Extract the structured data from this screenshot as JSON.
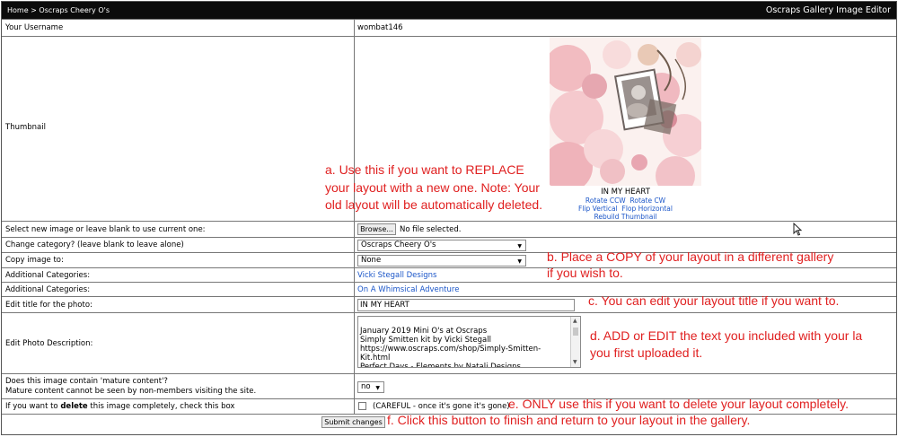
{
  "header": {
    "breadcrumb_home": "Home",
    "breadcrumb_sep": ">",
    "breadcrumb_gallery": "Oscraps Cheery O's",
    "title": "Oscraps Gallery Image Editor"
  },
  "form": {
    "username_label": "Your Username",
    "username_value": "wombat146",
    "thumbnail_label": "Thumbnail",
    "thumbnail_caption": "IN MY HEART",
    "rotate_ccw": "Rotate CCW",
    "rotate_cw": "Rotate CW",
    "flip_vertical": "Flip Vertical",
    "flop_horizontal": "Flop Horizontal",
    "rebuild_thumbnail": "Rebuild Thumbnail",
    "select_image_label": "Select new image or leave blank to use current one:",
    "browse_button": "Browse...",
    "no_file": "No file selected.",
    "change_category_label": "Change category? (leave blank to leave alone)",
    "change_category_value": "Oscraps Cheery O's",
    "copy_image_label": "Copy image to:",
    "copy_image_value": "None",
    "additional_categories_label_1": "Additional Categories:",
    "additional_category_1": "Vicki Stegall Designs",
    "additional_categories_label_2": "Additional Categories:",
    "additional_category_2": "On A Whimsical Adventure",
    "edit_title_label": "Edit title for the photo:",
    "edit_title_value": "IN MY HEART",
    "edit_description_label": "Edit Photo Description:",
    "description_value": "January 2019 Mini O's at Oscraps\nSimply Smitten kit by Vicki Stegall\nhttps://www.oscraps.com/shop/Simply-Smitten-Kit.html\nPerfect Days - Elements by Natali Designs\nhttps://www.oscraps.com/shop/Perfect-Days-Elements.html",
    "mature_label_line1": "Does this image contain 'mature content'?",
    "mature_label_line2": "Mature content cannot be seen by non-members visiting the site.",
    "mature_value": "no",
    "delete_label_prefix": "If you want to ",
    "delete_label_bold": "delete",
    "delete_label_suffix": " this image completely, check this box",
    "delete_note": "(CAREFUL - once it's gone it's gone)",
    "submit_button": "Submit changes"
  },
  "annotations": {
    "a_line1": "a. Use this if you want to REPLACE",
    "a_line2": "your layout with a new one. Note: Your",
    "a_line3": "old layout will be automatically deleted.",
    "b_line1": "b. Place a COPY of your layout in a different gallery",
    "b_line2": "if you wish to.",
    "c": "c. You can edit your layout title if you want to.",
    "d_line1": "d. ADD or EDIT the text you included with your la",
    "d_line2": "you first uploaded it.",
    "e": "e. ONLY use this if you want to delete your layout completely.",
    "f": "f. Click this button to finish and return to your layout in the gallery."
  },
  "icons": {
    "select_arrow": "chevron-down-icon",
    "mouse_cursor": "cursor-icon"
  },
  "colors": {
    "header_bg": "#0b0b0b",
    "link": "#1a55c8",
    "annotation": "#e02020"
  }
}
